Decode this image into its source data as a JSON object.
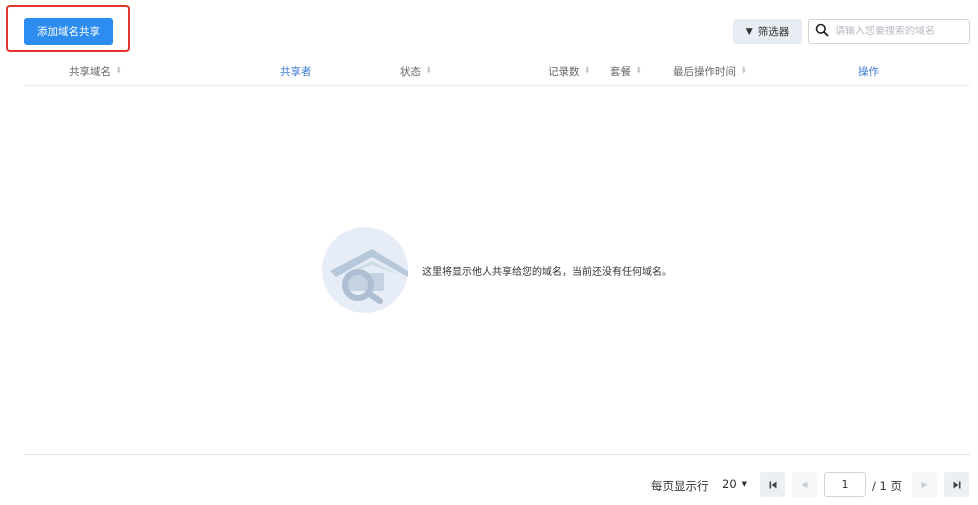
{
  "toolbar": {
    "add_label": "添加域名共享",
    "filter_label": "筛选器",
    "search_placeholder": "请输入您要搜索的域名",
    "search_value": ""
  },
  "table": {
    "columns": [
      {
        "label": "共享域名",
        "sortable": true
      },
      {
        "label": "共享者",
        "sortable": false
      },
      {
        "label": "状态",
        "sortable": true
      },
      {
        "label": "记录数",
        "sortable": true
      },
      {
        "label": "套餐",
        "sortable": true
      },
      {
        "label": "最后操作时间",
        "sortable": true
      },
      {
        "label": "操作",
        "sortable": false
      }
    ],
    "rows": []
  },
  "empty_state": {
    "message": "这里将显示他人共享给您的域名，当前还没有任何域名。"
  },
  "pagination": {
    "per_page_label": "每页显示行",
    "page_size": "20",
    "current_page": "1",
    "total_label": "/ 1 页"
  },
  "colors": {
    "primary": "#2d8cf0",
    "highlight": "#e0342c"
  }
}
